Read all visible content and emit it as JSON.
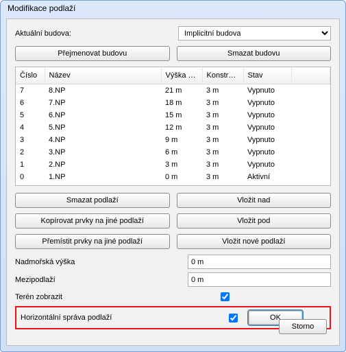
{
  "window": {
    "title": "Modifikace podlaží"
  },
  "building": {
    "label": "Aktuální budova:",
    "selected": "Implicitní budova",
    "rename_btn": "Přejmenovat budovu",
    "delete_btn": "Smazat budovu"
  },
  "table": {
    "headers": {
      "num": "Číslo",
      "name": "Název",
      "height": "Výška o...",
      "konstru": "Konstru...",
      "state": "Stav"
    },
    "rows": [
      {
        "num": "7",
        "name": "8.NP",
        "height": "21 m",
        "konstru": "3 m",
        "state": "Vypnuto"
      },
      {
        "num": "6",
        "name": "7.NP",
        "height": "18 m",
        "konstru": "3 m",
        "state": "Vypnuto"
      },
      {
        "num": "5",
        "name": "6.NP",
        "height": "15 m",
        "konstru": "3 m",
        "state": "Vypnuto"
      },
      {
        "num": "4",
        "name": "5.NP",
        "height": "12 m",
        "konstru": "3 m",
        "state": "Vypnuto"
      },
      {
        "num": "3",
        "name": "4.NP",
        "height": "9 m",
        "konstru": "3 m",
        "state": "Vypnuto"
      },
      {
        "num": "2",
        "name": "3.NP",
        "height": "6 m",
        "konstru": "3 m",
        "state": "Vypnuto"
      },
      {
        "num": "1",
        "name": "2.NP",
        "height": "3 m",
        "konstru": "3 m",
        "state": "Vypnuto"
      },
      {
        "num": "0",
        "name": "1.NP",
        "height": "0 m",
        "konstru": "3 m",
        "state": "Aktivní"
      }
    ]
  },
  "floor_ops": {
    "delete": "Smazat podlaží",
    "insert_above": "Vložit nad",
    "copy_elems": "Kopírovat prvky na jiné podlaží",
    "insert_below": "Vložit pod",
    "move_elems": "Přemístit prvky na jiné podlaží",
    "insert_new": "Vložit nové podlaží"
  },
  "fields": {
    "elev_label": "Nadmořská výška",
    "elev_value": "0 m",
    "interfloor_label": "Mezipodlaží",
    "interfloor_value": "0 m",
    "terrain_label": "Terén zobrazit",
    "horiz_label": "Horizontální správa podlaží"
  },
  "buttons": {
    "ok": "OK",
    "storno": "Storno"
  }
}
